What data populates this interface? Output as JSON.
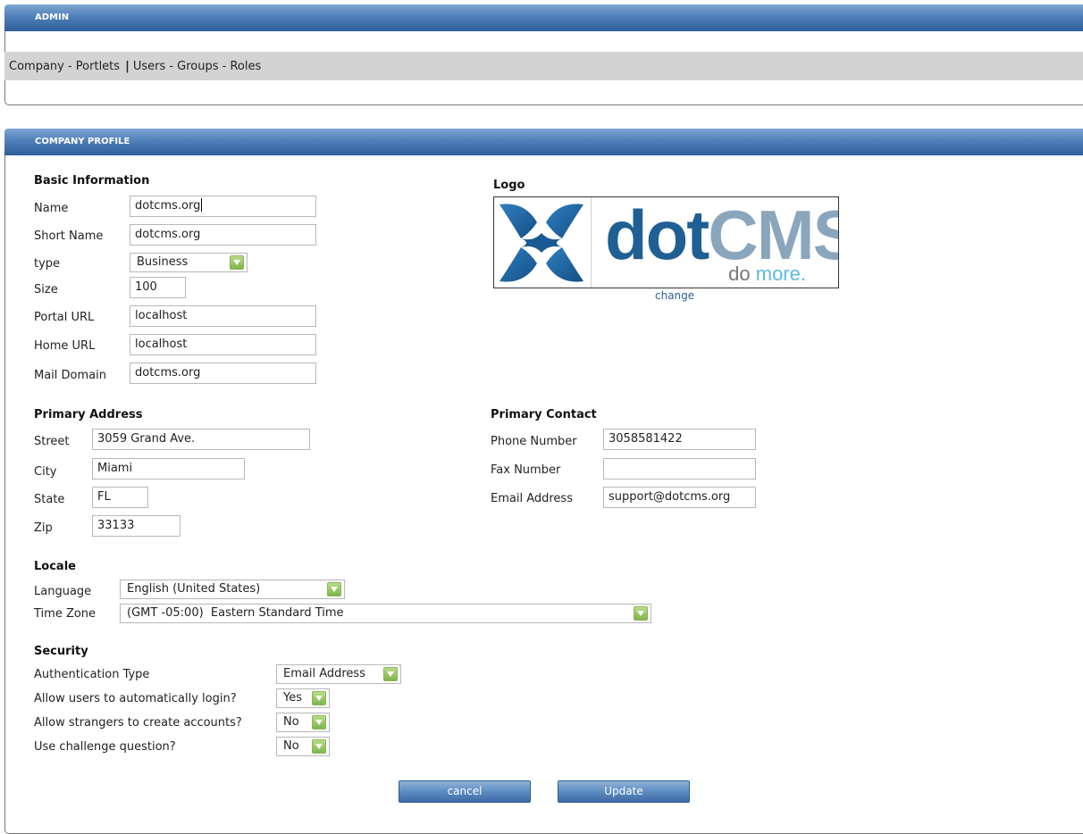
{
  "admin_panel": {
    "title": "ADMIN",
    "nav": {
      "company_portlets": "Company - Portlets",
      "separator": "|",
      "users_groups_roles": "Users - Groups - Roles"
    }
  },
  "company_panel": {
    "title": "COMPANY PROFILE"
  },
  "basic_info": {
    "heading": "Basic Information",
    "name_label": "Name",
    "name_value": "dotcms.org",
    "short_name_label": "Short Name",
    "short_name_value": "dotcms.org",
    "type_label": "type",
    "type_value": "Business",
    "size_label": "Size",
    "size_value": "100",
    "portal_url_label": "Portal URL",
    "portal_url_value": "localhost",
    "home_url_label": "Home URL",
    "home_url_value": "localhost",
    "mail_domain_label": "Mail Domain",
    "mail_domain_value": "dotcms.org"
  },
  "logo": {
    "heading": "Logo",
    "word_dot": "dot",
    "word_cms": "CMS",
    "tagline_do": "do ",
    "tagline_more": "more.",
    "change_link": "change"
  },
  "primary_address": {
    "heading": "Primary Address",
    "street_label": "Street",
    "street_value": "3059 Grand Ave.",
    "city_label": "City",
    "city_value": "Miami",
    "state_label": "State",
    "state_value": "FL",
    "zip_label": "Zip",
    "zip_value": "33133"
  },
  "primary_contact": {
    "heading": "Primary Contact",
    "phone_label": "Phone Number",
    "phone_value": "3058581422",
    "fax_label": "Fax Number",
    "fax_value": "",
    "email_label": "Email Address",
    "email_value": "support@dotcms.org"
  },
  "locale": {
    "heading": "Locale",
    "language_label": "Language",
    "language_value": "English (United States)",
    "timezone_label": "Time Zone",
    "timezone_value": "(GMT -05:00)  Eastern Standard Time"
  },
  "security": {
    "heading": "Security",
    "auth_type_label": "Authentication Type",
    "auth_type_value": "Email Address",
    "auto_login_label": "Allow users to automatically login?",
    "auto_login_value": "Yes",
    "strangers_label": "Allow strangers to create accounts?",
    "strangers_value": "No",
    "challenge_label": "Use challenge question?",
    "challenge_value": "No"
  },
  "buttons": {
    "cancel": "cancel",
    "update": "Update"
  },
  "colors": {
    "header_blue": "#2e5f9a",
    "nav_gray": "#d3d3d3",
    "select_arrow_green": "#7fb54a",
    "logo_dark_blue": "#1f5f94",
    "logo_light_blue": "#8aa6bd",
    "link_blue": "#2a5d94"
  }
}
